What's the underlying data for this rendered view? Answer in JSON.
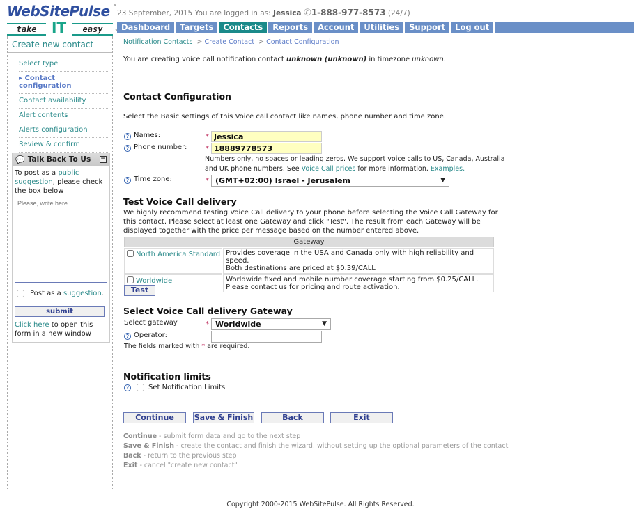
{
  "header": {
    "logo": {
      "brand": "WebSitePulse",
      "tm": "™",
      "tag_take": "take",
      "tag_it": "IT",
      "tag_easy": "easy"
    },
    "date": "23 September, 2015",
    "logged_in_prefix": "You are logged in as:",
    "username": "Jessica",
    "phone": "1-888-977-8573",
    "phone_hours": "(24/7)"
  },
  "nav": {
    "items": [
      {
        "label": "Dashboard",
        "active": false
      },
      {
        "label": "Targets",
        "active": false
      },
      {
        "label": "Contacts",
        "active": true
      },
      {
        "label": "Reports",
        "active": false
      },
      {
        "label": "Account",
        "active": false
      },
      {
        "label": "Utilities",
        "active": false
      },
      {
        "label": "Support",
        "active": false
      },
      {
        "label": "Log out",
        "active": false
      }
    ],
    "accent_color": "#6a8fc7",
    "active_color": "#1a8a8a"
  },
  "sidebar": {
    "title": "Create new contact",
    "steps": [
      {
        "label": "Select type",
        "current": false
      },
      {
        "label": "▸ Contact configuration",
        "current": true
      },
      {
        "label": "Contact availability",
        "current": false
      },
      {
        "label": "Alert contents",
        "current": false
      },
      {
        "label": "Alerts configuration",
        "current": false
      },
      {
        "label": "Review & confirm",
        "current": false
      }
    ],
    "talkback": {
      "title": "Talk Back To Us",
      "intro_pre": "To post as a ",
      "intro_link": "public suggestion",
      "intro_post": ", please check the box below",
      "textarea_placeholder": "Please, write here...",
      "check_pre": "Post as a ",
      "check_link": "suggestion",
      "check_post": ".",
      "submit_label": "submit",
      "foot_link": "Click here",
      "foot_text": " to open this form in a new window"
    }
  },
  "main": {
    "breadcrumb": [
      "Notification Contacts",
      "Create Contact",
      "Contact Configuration"
    ],
    "breadcrumb_sep": ">",
    "intro": {
      "pre": "You are creating voice call notification contact ",
      "name": "unknown",
      "paren": "(unknown)",
      "mid": " in timezone ",
      "tz": "unknown",
      "end": "."
    },
    "config": {
      "title": "Contact Configuration",
      "desc": "Select the Basic settings of this Voice call contact like names, phone number and time zone.",
      "names_label": "Names:",
      "names_value": "Jessica",
      "phone_label": "Phone number:",
      "phone_value": "18889778573",
      "phone_hint_1": "Numbers only, no spaces or leading zeros. We support voice calls to US, Canada, Australia",
      "phone_hint_2_pre": "and UK phone numbers. See ",
      "phone_hint_link1": "Voice Call prices",
      "phone_hint_2_mid": " for more information. ",
      "phone_hint_link2": "Examples.",
      "tz_label": "Time zone:",
      "tz_value": "(GMT+02:00) Israel - Jerusalem"
    },
    "test": {
      "title": "Test Voice Call delivery",
      "desc": "We highly recommend testing Voice Call delivery to your phone before selecting the Voice Call Gateway for this contact. Please select at least one Gateway and click \"Test\". The result from each Gateway will be displayed together with the price per message based on the number entered above.",
      "table_header": "Gateway",
      "gateways": [
        {
          "name": "North America Standard",
          "checked": false,
          "desc_1": "Provides coverage in the USA and Canada only with high reliability and speed.",
          "desc_2": "Both destinations are priced at $0.39/CALL"
        },
        {
          "name": "Worldwide",
          "checked": false,
          "desc_1": "Worldwide fixed and mobile number coverage starting from $0.25/CALL.",
          "desc_2": "Please contact us for pricing and route activation."
        }
      ],
      "test_button": "Test"
    },
    "gateway": {
      "title": "Select Voice Call delivery Gateway",
      "select_label": "Select gateway",
      "select_value": "Worldwide",
      "operator_label": "Operator:",
      "operator_value": "",
      "required_pre": "The fields marked with ",
      "required_star": "*",
      "required_post": " are required."
    },
    "limits": {
      "title": "Notification limits",
      "checkbox_label": "Set Notification Limits",
      "checked": false
    },
    "buttons": {
      "continue": "Continue",
      "save_finish": "Save & Finish",
      "back": "Back",
      "exit": "Exit"
    },
    "legend": [
      {
        "term": "Continue",
        "desc": " - submit form data and go to the next step"
      },
      {
        "term": "Save & Finish",
        "desc": " - create the contact and finish the wizard, without setting up the optional parameters of the contact"
      },
      {
        "term": "Back",
        "desc": " - return to the previous step"
      },
      {
        "term": "Exit",
        "desc": " - cancel \"create new contact\""
      }
    ]
  },
  "footer": {
    "copyright": "Copyright 2000-2015 WebSitePulse. All Rights Reserved."
  }
}
